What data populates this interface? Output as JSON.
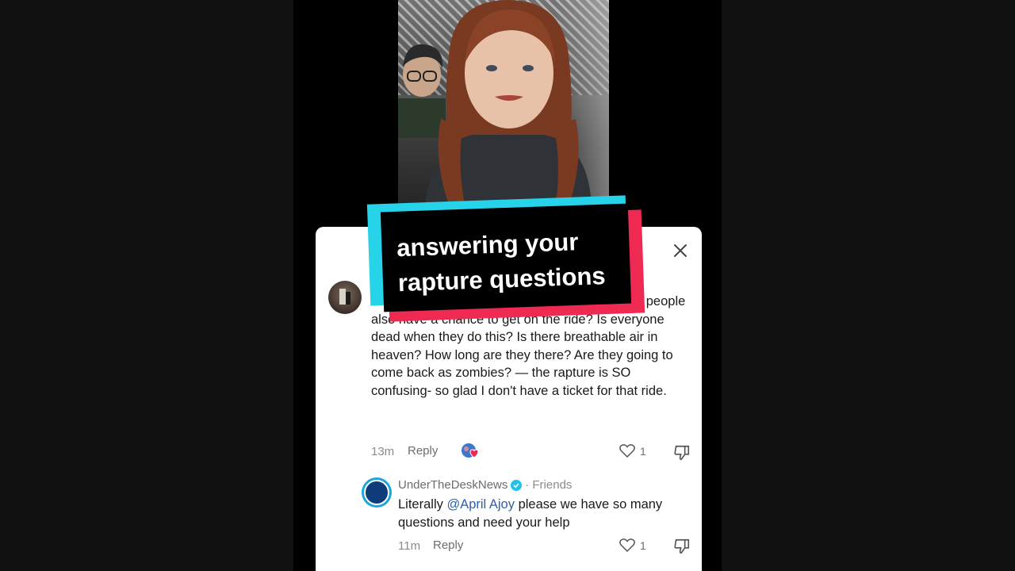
{
  "caption": {
    "line1": "answering your",
    "line2": "rapture questions"
  },
  "comment": {
    "text": "So ... people can ... bounce down? And Jewish people also have a chance to get on the ride? Is everyone dead when they do this? Is there breathable air in heaven? How long are they there? Are they going to come back as zombies? — the rapture is SO confusing- so glad I don't have a ticket for that ride.",
    "time": "13m",
    "reply_label": "Reply",
    "like_count": "1"
  },
  "reply": {
    "username": "UnderTheDeskNews",
    "separator": "·",
    "badge": "Friends",
    "text_before": "Literally ",
    "mention": "@April Ajoy",
    "text_after": " please we have so many questions and need your help",
    "time": "11m",
    "reply_label": "Reply",
    "like_count": "1"
  },
  "icons": {
    "close": "close-icon",
    "heart": "heart-icon",
    "dislike": "thumbs-down-icon",
    "verified": "verified-check-icon",
    "reaction": "creator-liked-icon"
  },
  "colors": {
    "accent_cyan": "#26d3e8",
    "accent_red": "#ef2a52",
    "mention_blue": "#2f5ea8"
  }
}
